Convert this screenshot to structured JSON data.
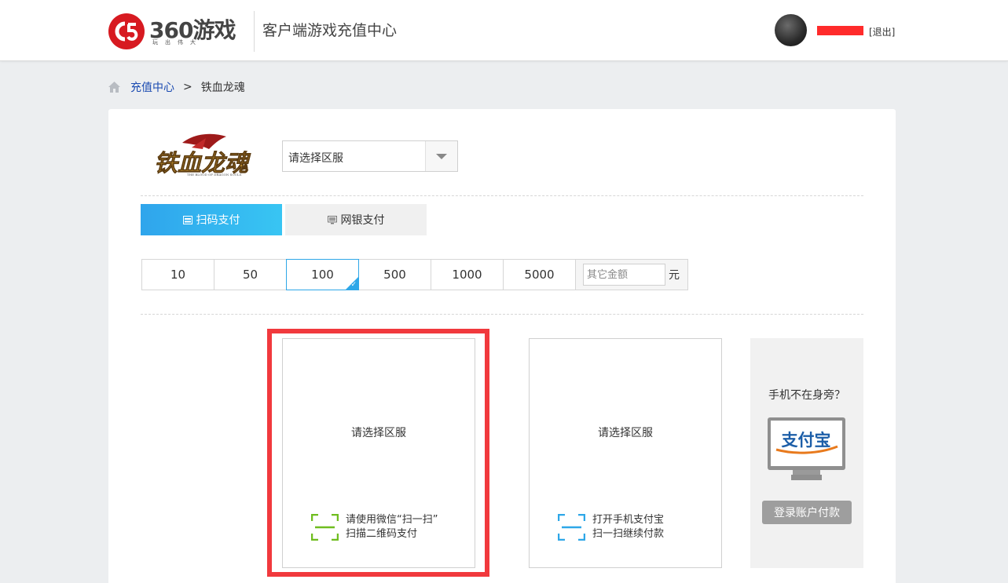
{
  "header": {
    "logo_text": "360游戏",
    "logo_sub": "玩出伟大",
    "title": "客户端游戏充值中心",
    "logout_label": "[退出]"
  },
  "breadcrumb": {
    "home": "充值中心",
    "separator": ">",
    "current": "铁血龙魂"
  },
  "game": {
    "logo_text": "铁血龙魂",
    "server_select": {
      "selected": "请选择区服"
    }
  },
  "payment_tabs": [
    {
      "label": "扫码支付",
      "active": true,
      "icon": "qr-card-icon"
    },
    {
      "label": "网银支付",
      "active": false,
      "icon": "monitor-icon"
    }
  ],
  "amounts": {
    "options": [
      "10",
      "50",
      "100",
      "500",
      "1000",
      "5000"
    ],
    "selected": "100",
    "other_placeholder": "其它金额",
    "unit": "元"
  },
  "wechat_qr": {
    "message": "请选择区服",
    "hint_line1": "请使用微信“扫一扫”",
    "hint_line2": "扫描二维码支付",
    "accent": "#6fbd1f"
  },
  "alipay_qr": {
    "message": "请选择区服",
    "hint_line1": "打开手机支付宝",
    "hint_line2": "扫一扫继续付款",
    "accent": "#2ea7e8"
  },
  "alipay_side": {
    "question": "手机不在身旁？",
    "logo_text": "支付宝",
    "button_label": "登录账户付款"
  },
  "colors": {
    "highlight_frame": "#f1393d",
    "brand_red": "#d71a21",
    "tab_active": "#2fa5ec",
    "link": "#1a4ab1"
  }
}
